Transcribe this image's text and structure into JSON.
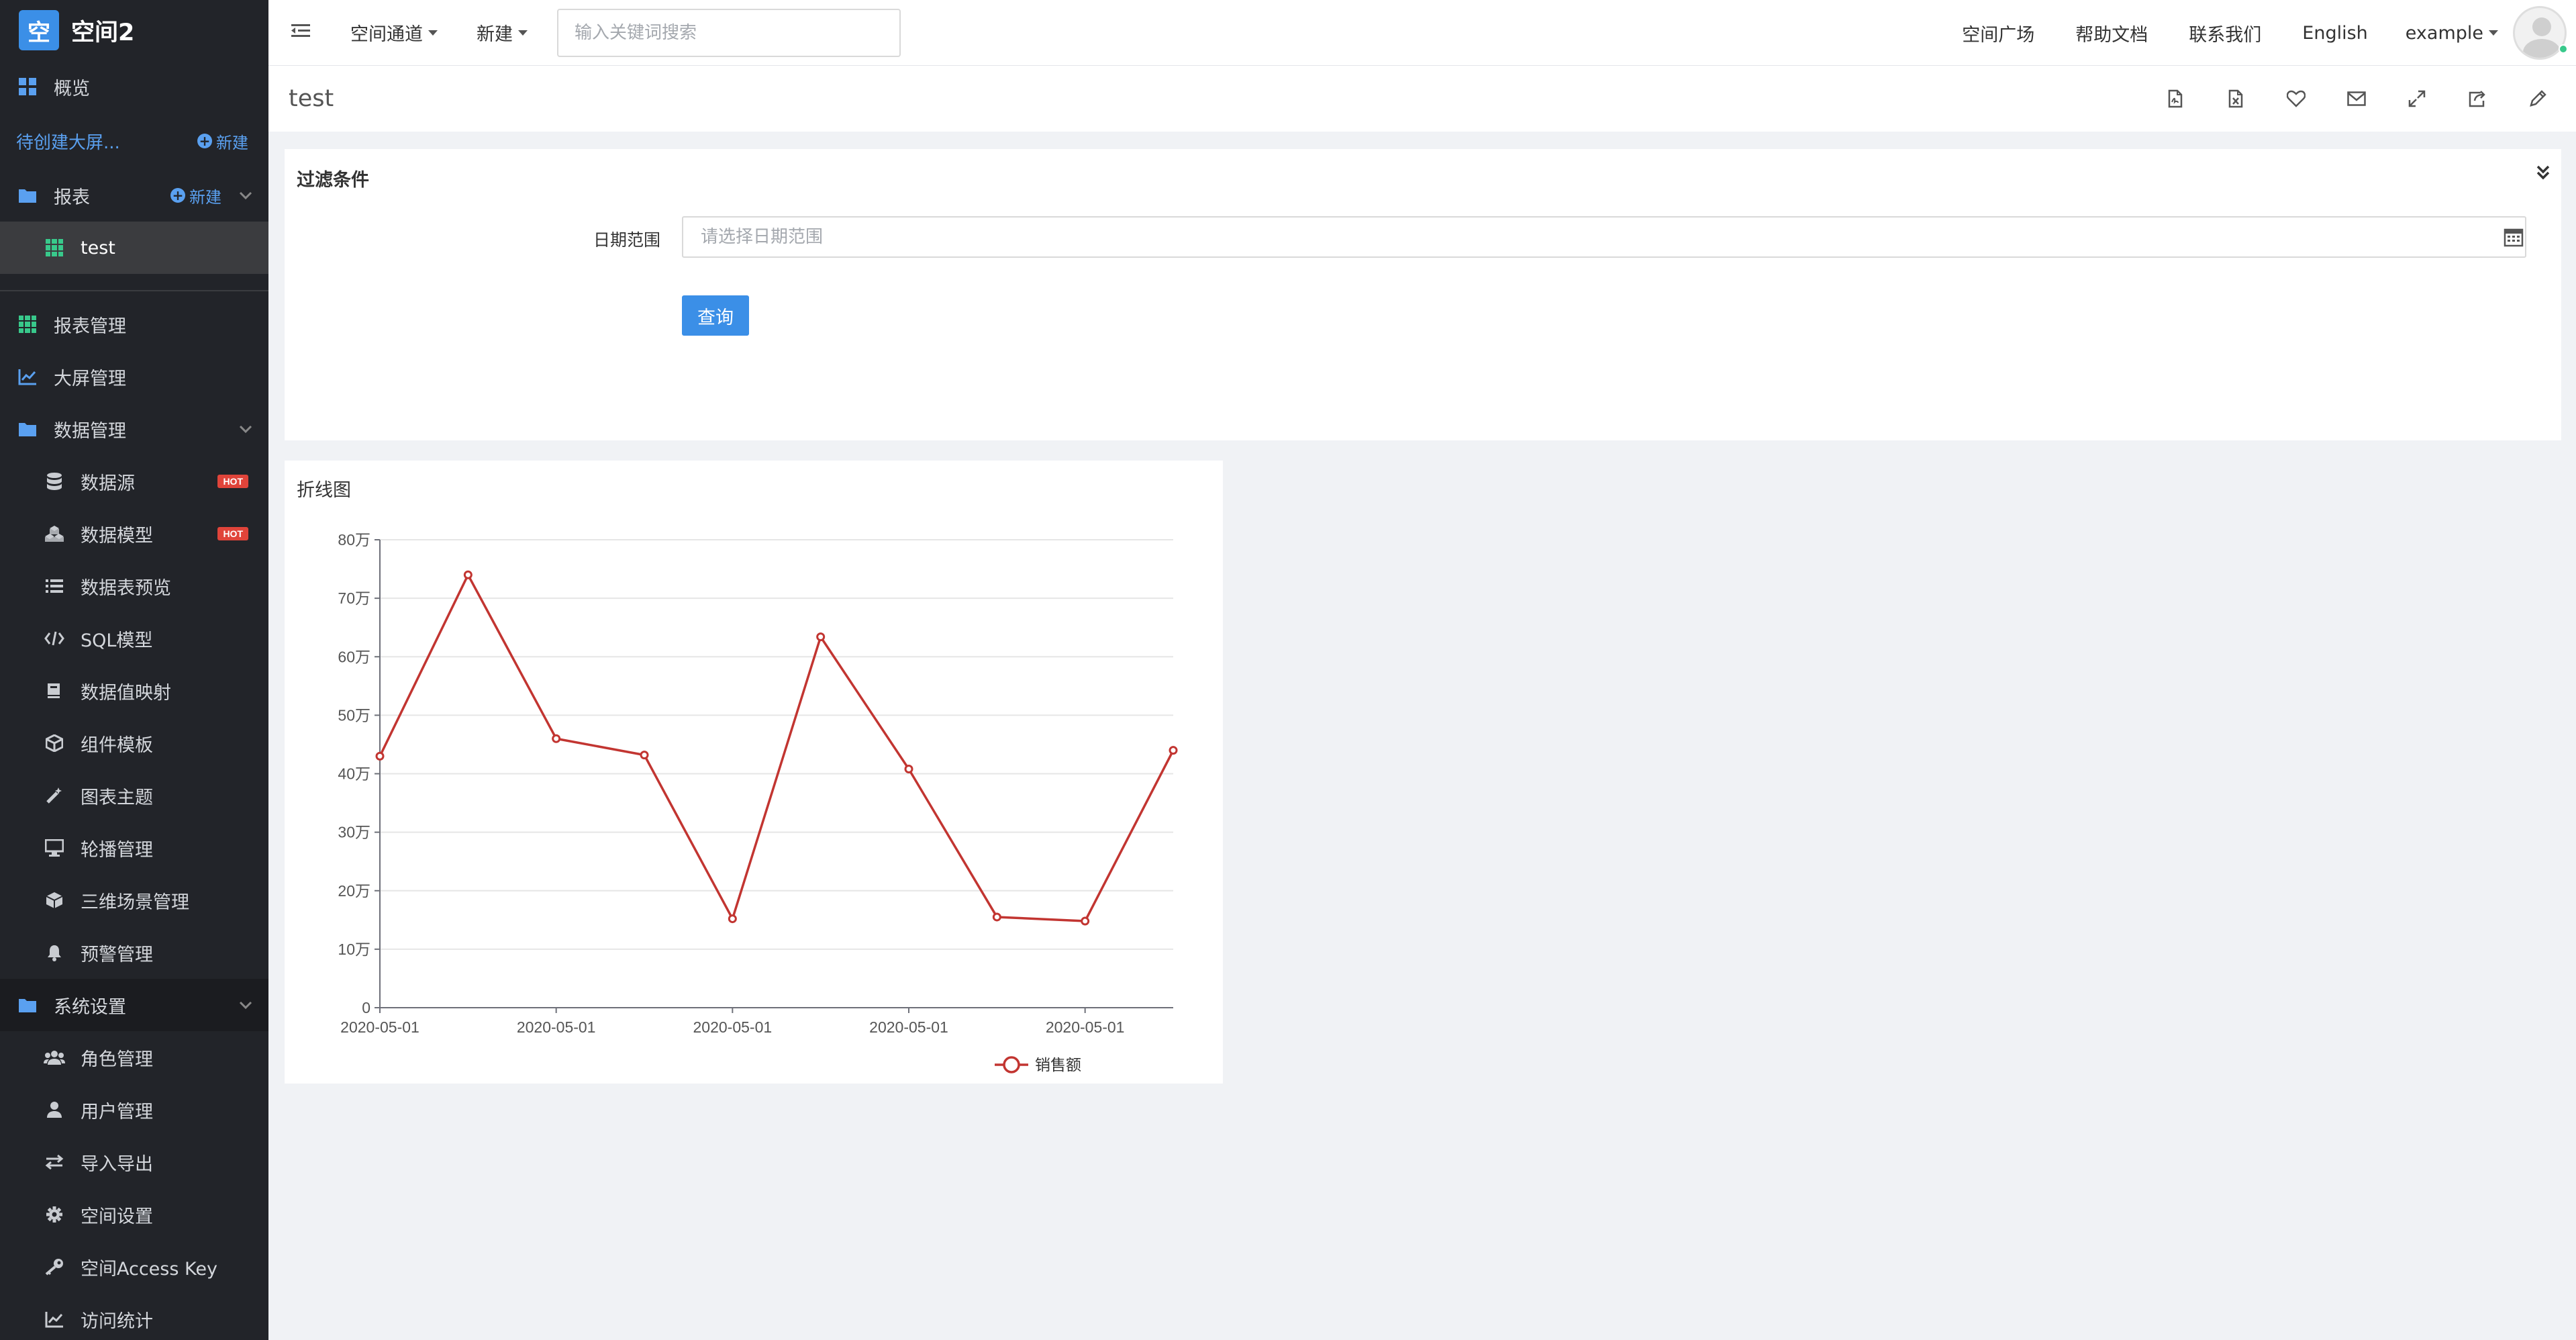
{
  "brand": {
    "logo_char": "空",
    "name": "空间2"
  },
  "sidebar": {
    "overview": "概览",
    "pending": {
      "label": "待创建大屏...",
      "new_label": "新建"
    },
    "reports": {
      "label": "报表",
      "new_label": "新建",
      "child": "test"
    },
    "items": [
      {
        "label": "报表管理"
      },
      {
        "label": "大屏管理"
      },
      {
        "label": "数据管理"
      }
    ],
    "data_mgmt": [
      {
        "label": "数据源",
        "badge": "HOT"
      },
      {
        "label": "数据模型",
        "badge": "HOT"
      },
      {
        "label": "数据表预览"
      },
      {
        "label": "SQL模型"
      },
      {
        "label": "数据值映射"
      },
      {
        "label": "组件模板"
      },
      {
        "label": "图表主题"
      },
      {
        "label": "轮播管理"
      },
      {
        "label": "三维场景管理"
      },
      {
        "label": "预警管理"
      }
    ],
    "system": {
      "label": "系统设置"
    },
    "system_items": [
      {
        "label": "角色管理"
      },
      {
        "label": "用户管理"
      },
      {
        "label": "导入导出"
      },
      {
        "label": "空间设置"
      },
      {
        "label": "空间Access Key"
      },
      {
        "label": "访问统计"
      }
    ]
  },
  "topbar": {
    "space_channel": "空间通道",
    "new_menu": "新建",
    "search_placeholder": "输入关键词搜索",
    "links": [
      "空间广场",
      "帮助文档",
      "联系我们",
      "English"
    ],
    "user": "example"
  },
  "page": {
    "title": "test"
  },
  "filter": {
    "title": "过滤条件",
    "date_label": "日期范围",
    "date_placeholder": "请选择日期范围",
    "query_label": "查询"
  },
  "chart": {
    "title": "折线图"
  },
  "colors": {
    "accent": "#3b8fe7",
    "series": "#c23531",
    "sidebar_bg": "#222429"
  },
  "chart_data": {
    "type": "line",
    "x": [
      "2020-05-01",
      "2020-05-01",
      "2020-05-01",
      "2020-05-01",
      "2020-05-01",
      "2020-05-01",
      "2020-05-01",
      "2020-05-01",
      "2020-05-01",
      "2020-05-01"
    ],
    "x_tick_labels": [
      "2020-05-01",
      "2020-05-01",
      "2020-05-01",
      "2020-05-01",
      "2020-05-01"
    ],
    "series": [
      {
        "name": "销售额",
        "values": [
          430000,
          740000,
          460000,
          432000,
          152000,
          634000,
          408000,
          155000,
          148000,
          440000
        ]
      }
    ],
    "y_ticks": [
      "0",
      "10万",
      "20万",
      "30万",
      "40万",
      "50万",
      "60万",
      "70万",
      "80万"
    ],
    "ylim": [
      0,
      800000
    ],
    "grid": true,
    "legend": "bottom-center"
  }
}
